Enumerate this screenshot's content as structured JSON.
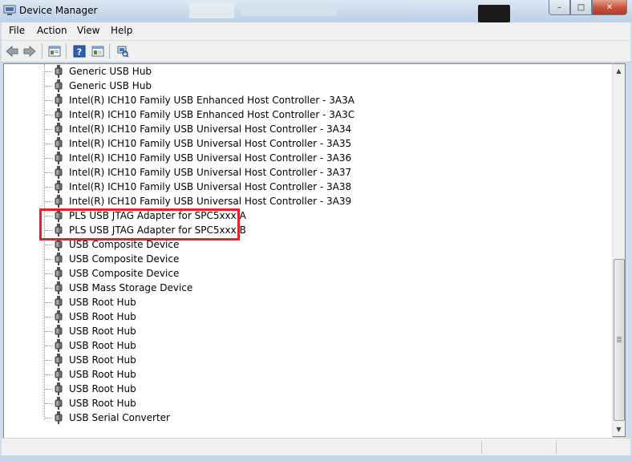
{
  "window": {
    "title": "Device Manager"
  },
  "caption": {
    "minimize": "–",
    "maximize": "□",
    "close": "✕"
  },
  "menu": [
    "File",
    "Action",
    "View",
    "Help"
  ],
  "toolbar": {
    "icons": [
      "back-icon",
      "forward-icon",
      "properties-icon",
      "help-icon",
      "show-hide-icon",
      "scan-hardware-icon"
    ]
  },
  "tree": {
    "items": [
      "Generic USB Hub",
      "Generic USB Hub",
      "Intel(R) ICH10 Family USB Enhanced Host Controller - 3A3A",
      "Intel(R) ICH10 Family USB Enhanced Host Controller - 3A3C",
      "Intel(R) ICH10 Family USB Universal Host Controller - 3A34",
      "Intel(R) ICH10 Family USB Universal Host Controller - 3A35",
      "Intel(R) ICH10 Family USB Universal Host Controller - 3A36",
      "Intel(R) ICH10 Family USB Universal Host Controller - 3A37",
      "Intel(R) ICH10 Family USB Universal Host Controller - 3A38",
      "Intel(R) ICH10 Family USB Universal Host Controller - 3A39",
      "PLS USB JTAG Adapter for SPC5xxx A",
      "PLS USB JTAG Adapter for SPC5xxx B",
      "USB Composite Device",
      "USB Composite Device",
      "USB Composite Device",
      "USB Mass Storage Device",
      "USB Root Hub",
      "USB Root Hub",
      "USB Root Hub",
      "USB Root Hub",
      "USB Root Hub",
      "USB Root Hub",
      "USB Root Hub",
      "USB Root Hub",
      "USB Serial Converter"
    ]
  },
  "colors": {
    "highlight": "#e8202a"
  }
}
